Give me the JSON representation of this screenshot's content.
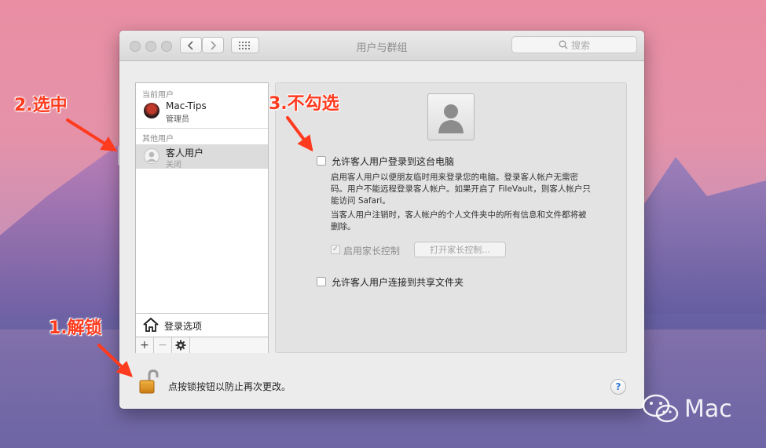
{
  "window": {
    "title": "用户与群组",
    "search_placeholder": "搜索"
  },
  "sidebar": {
    "current_users_header": "当前用户",
    "current_user": {
      "name": "Mac-Tips",
      "role": "管理员"
    },
    "other_users_header": "其他用户",
    "guest_user": {
      "name": "客人用户",
      "status": "关闭"
    },
    "login_options_label": "登录选项",
    "toolbar": {
      "add": "+",
      "remove": "−"
    }
  },
  "content": {
    "allow_guest_login_label": "允许客人用户登录到这台电脑",
    "desc1_line1": "启用客人用户以便朋友临时用来登录您的电脑。登录客人帐户无需密",
    "desc1_line2": "码。用户不能远程登录客人帐户。如果开启了 FileVault，则客人帐户只",
    "desc1_line3": "能访问 Safari。",
    "desc2_line1": "当客人用户注销时，客人帐户的个人文件夹中的所有信息和文件都将被",
    "desc2_line2": "删除。",
    "parental_controls_label": "启用家长控制",
    "open_parental_controls_button": "打开家长控制...",
    "allow_guest_shared_folders_label": "允许客人用户连接到共享文件夹"
  },
  "footer": {
    "lock_text": "点按锁按钮以防止再次更改。",
    "help": "?"
  },
  "annotations": {
    "step1": "1.解锁",
    "step2": "2.选中",
    "step3": "3.不勾选"
  },
  "watermark": {
    "text": "Mac"
  },
  "colors": {
    "annotation": "#ff3b1f",
    "selection": "#dcdcdc",
    "help_blue": "#2f7bdc"
  }
}
